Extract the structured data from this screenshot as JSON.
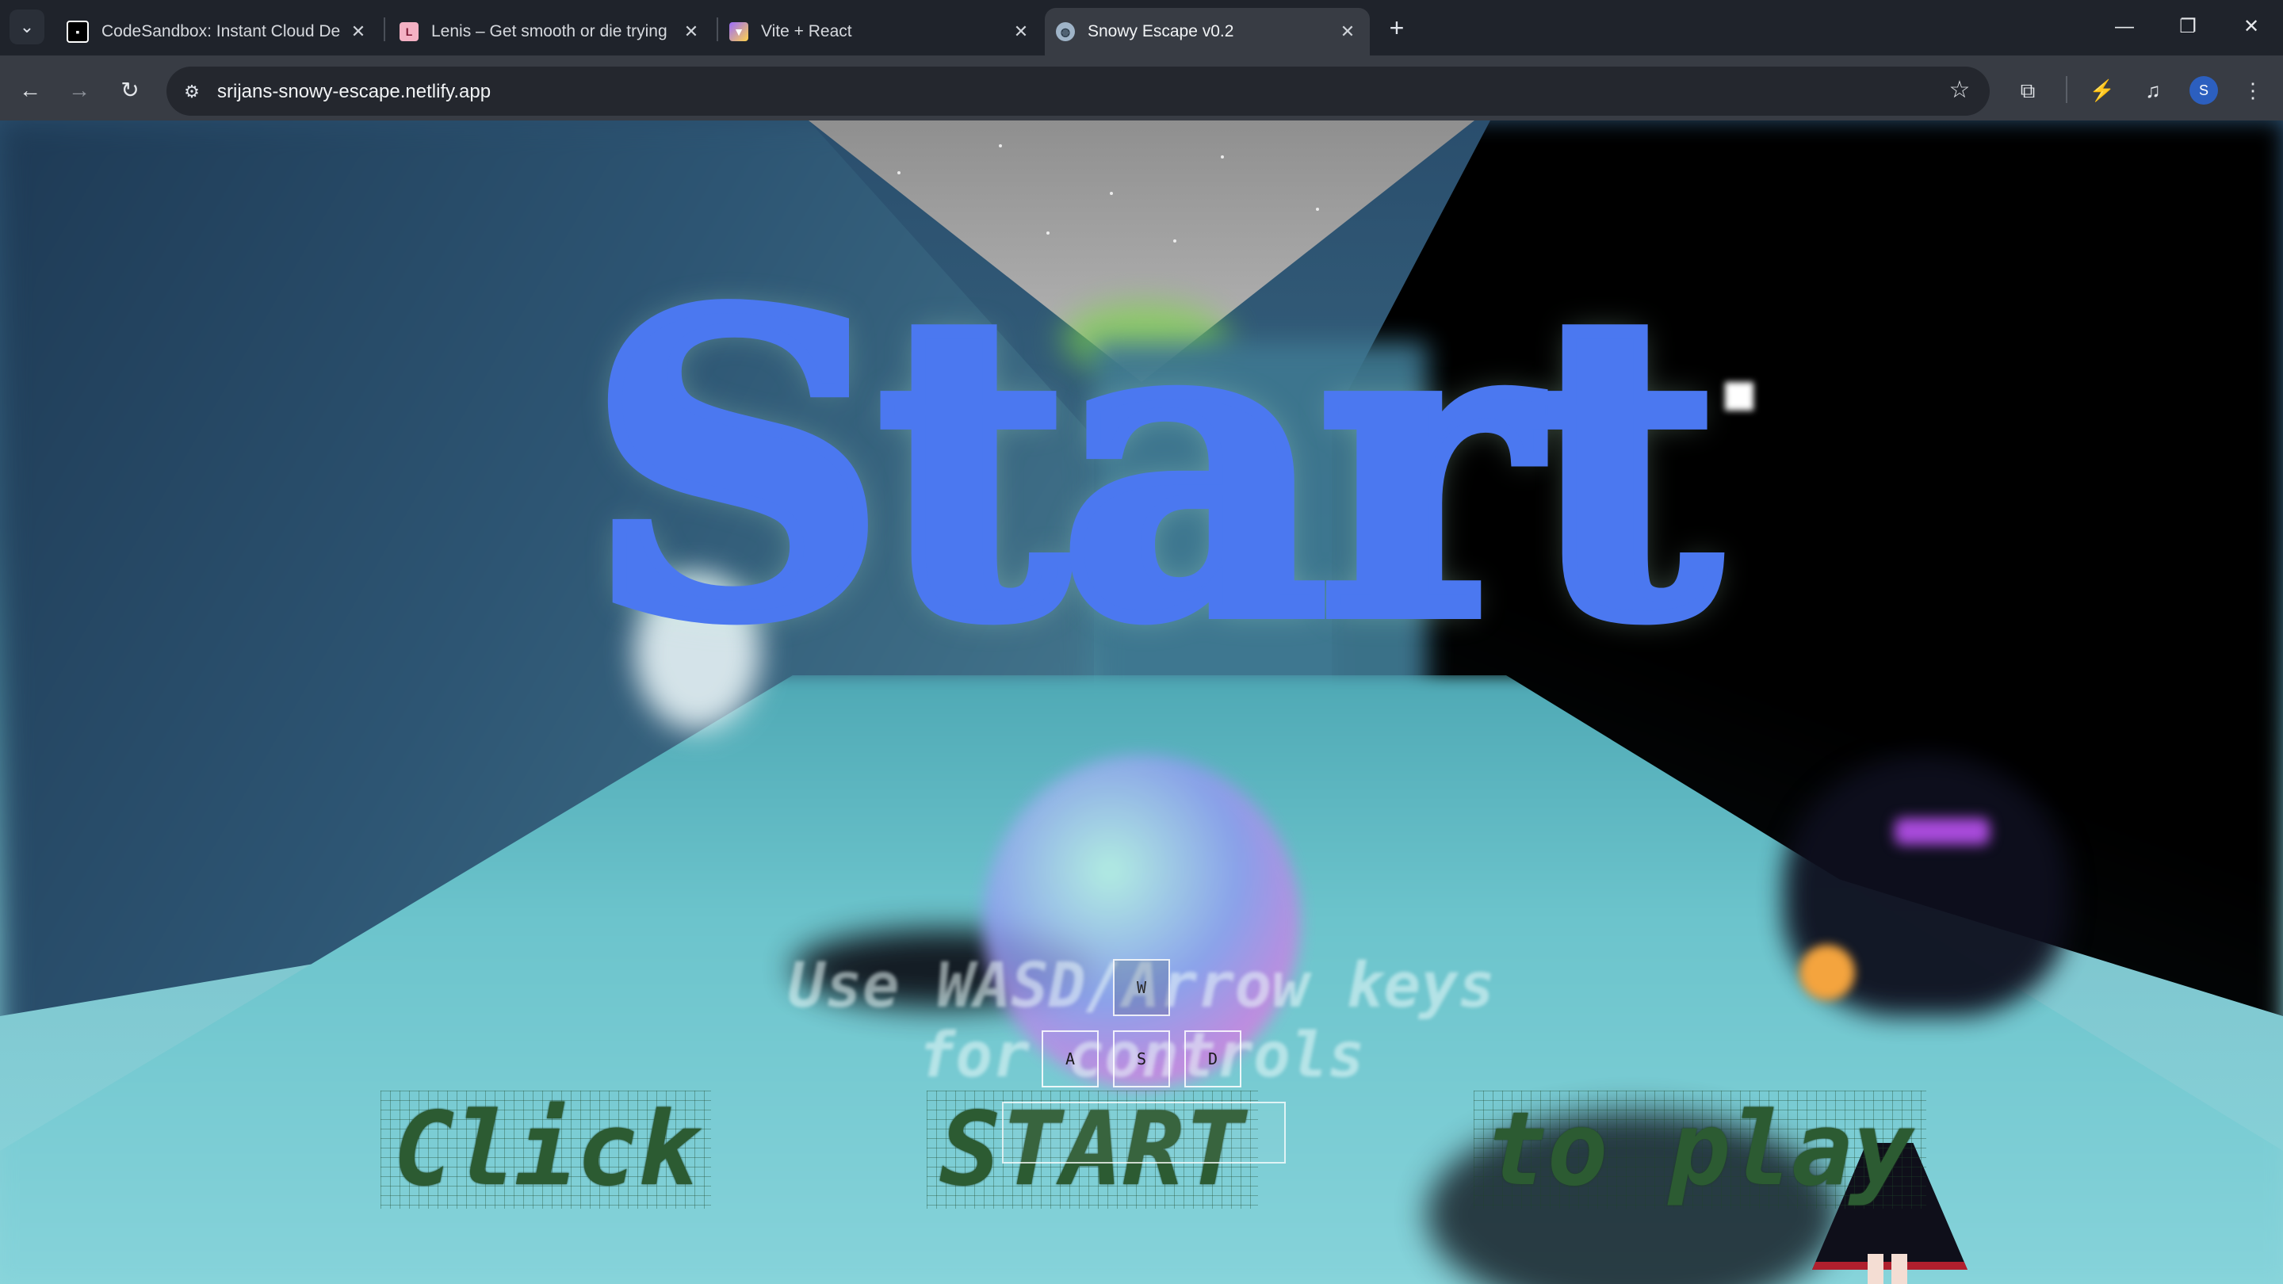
{
  "browser": {
    "tabs": [
      {
        "title": "CodeSandbox: Instant Cloud De",
        "favicon": "codesandbox-icon",
        "active": false
      },
      {
        "title": "Lenis – Get smooth or die trying",
        "favicon": "lenis-icon",
        "active": false
      },
      {
        "title": "Vite + React",
        "favicon": "vite-icon",
        "active": false
      },
      {
        "title": "Snowy Escape v0.2",
        "favicon": "globe-icon",
        "active": true
      }
    ],
    "url": "srijans-snowy-escape.netlify.app",
    "profile_initial": "S",
    "colors": {
      "accent_profile": "#2c5fbf",
      "tab_active": "#383c44",
      "tab_bar": "#1f232b"
    }
  },
  "game": {
    "title": "Start",
    "hint_line1": "Use WASD/Arrow keys",
    "hint_line2": "for controls",
    "click_words": [
      "Click",
      "START",
      "to play"
    ],
    "keys": {
      "up": "W",
      "left": "A",
      "down": "S",
      "right": "D"
    },
    "colors": {
      "title": "#4b78f0",
      "floor_text": "#2c5b32",
      "floor": "#86d3da"
    }
  }
}
